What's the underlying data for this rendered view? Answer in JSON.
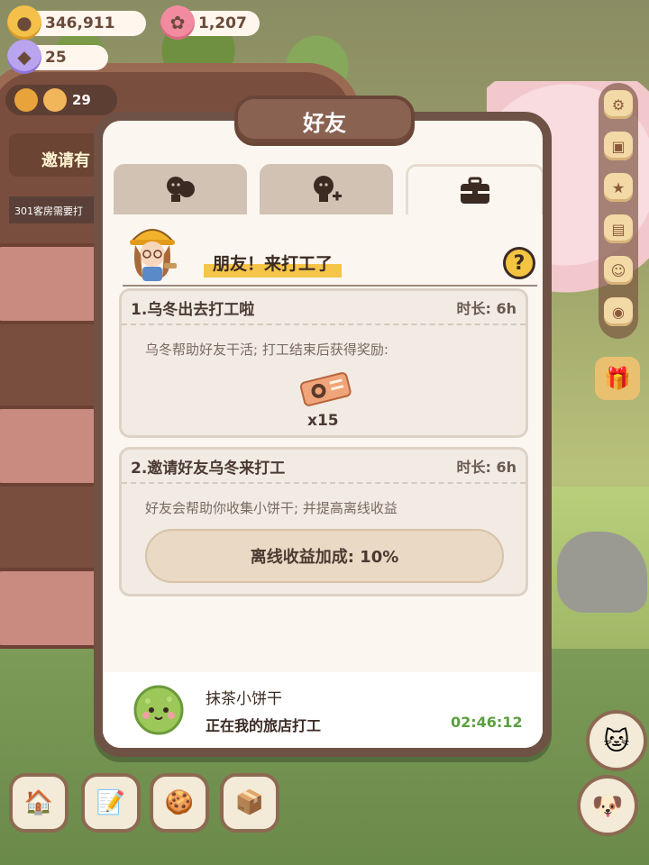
{
  "currencies": {
    "gold": "346,911",
    "pink": "1,207",
    "gem": "25"
  },
  "left_hud": {
    "level_count": "29",
    "invite_label": "邀请有",
    "task_text": "301客房需要打"
  },
  "modal": {
    "title": "好友",
    "tabs": [
      {
        "name": "friends",
        "icon": "friends-icon"
      },
      {
        "name": "add-friend",
        "icon": "add-friend-icon"
      },
      {
        "name": "work",
        "icon": "briefcase-icon",
        "active": true
      }
    ],
    "section_title": "朋友！来打工了",
    "cards": [
      {
        "title": "1.乌冬出去打工啦",
        "duration": "时长: 6h",
        "description": "乌冬帮助好友干活; 打工结束后获得奖励:",
        "reward_icon": "ticket-icon",
        "reward_count": "x15"
      },
      {
        "title": "2.邀请好友乌冬来打工",
        "duration": "时长: 6h",
        "description": "好友会帮助你收集小饼干; 并提高离线收益",
        "bonus_label": "离线收益加成: 10%"
      }
    ],
    "status": {
      "friend_name": "抹茶小饼干",
      "friend_status": "正在我的旅店打工",
      "timer": "02:46:12"
    }
  },
  "colors": {
    "modal_border": "#6f5246",
    "modal_bg": "#fbf7f0",
    "accent_yellow": "#f5c54a",
    "timer_green": "#5aa040"
  }
}
